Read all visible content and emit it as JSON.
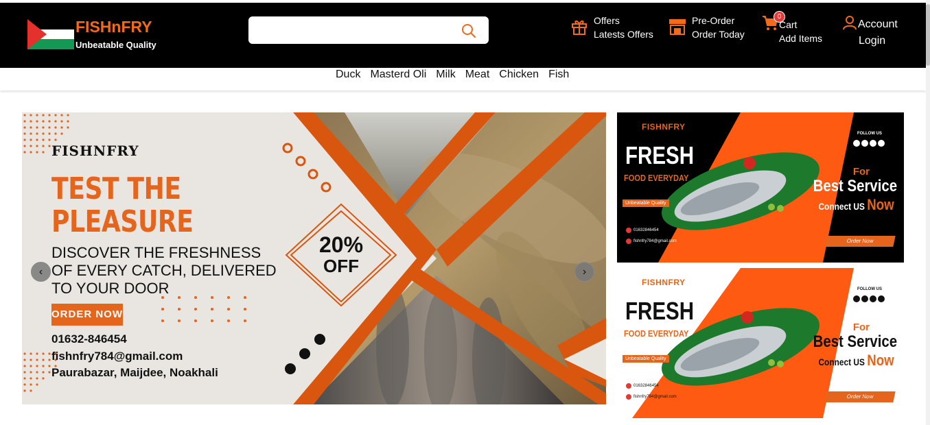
{
  "header": {
    "brand": "FISHnFRY",
    "tagline": "Unbeatable Quality",
    "search": {
      "placeholder": ""
    },
    "offers": {
      "title": "Offers",
      "subtitle": "Latests Offers"
    },
    "preorder": {
      "title": "Pre-Order",
      "subtitle": "Order Today"
    },
    "cart": {
      "title": "Cart",
      "subtitle": "Add Items",
      "count": "0"
    },
    "account": {
      "title": "Account",
      "subtitle": "Login"
    }
  },
  "categories": [
    "Duck",
    "Masterd Oli",
    "Milk",
    "Meat",
    "Chicken",
    "Fish"
  ],
  "hero": {
    "brand": "FISHNFRY",
    "title": "TEST THE PLEASURE",
    "subtitle": "DISCOVER THE FRESHNESS OF EVERY CATCH, DELIVERED TO YOUR DOOR",
    "order_button": "ORDER NOW",
    "phone": "01632-846454",
    "email": "fishnfry784@gmail.com",
    "address": "Paurabazar, Maijdee, Noakhali",
    "discount_percent": "20%",
    "discount_label": "OFF",
    "prev_arrow": "‹",
    "next_arrow": "›"
  },
  "promos": [
    {
      "brand": "FISHNFRY",
      "fresh": "FRESH",
      "everyday": "FOOD EVERYDAY",
      "quality": "Unbeatable Quality",
      "phone": "01632846454",
      "email": "fishnfry784@gmail.com",
      "follow": "FOLLOW US",
      "for": "For",
      "best": "Best Service",
      "connect": "Connect US",
      "now": "Now",
      "order": "Order Now"
    },
    {
      "brand": "FISHNFRY",
      "fresh": "FRESH",
      "everyday": "FOOD EVERYDAY",
      "quality": "Unbeatable Quality",
      "phone": "01632846454",
      "email": "fishnfry784@gmail.com",
      "follow": "FOLLOW US",
      "for": "For",
      "best": "Best Service",
      "connect": "Connect US",
      "now": "Now",
      "order": "Order Now"
    }
  ],
  "colors": {
    "accent": "#e4651b",
    "topbar": "#000000",
    "badge": "#e53935"
  }
}
